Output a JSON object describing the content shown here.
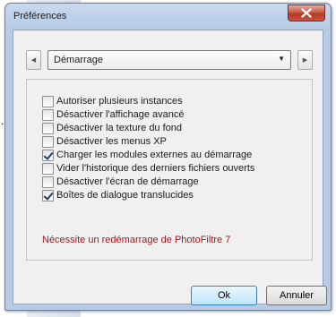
{
  "window": {
    "title": "Préférences",
    "close_icon": "close-icon"
  },
  "category": {
    "selected": "Démarrage",
    "prev_icon": "triangle-left-icon",
    "next_icon": "triangle-right-icon",
    "dropdown_icon": "triangle-down-icon"
  },
  "options": [
    {
      "label": "Autoriser plusieurs instances",
      "checked": false
    },
    {
      "label": "Désactiver l'affichage avancé",
      "checked": false
    },
    {
      "label": "Désactiver la texture du fond",
      "checked": false
    },
    {
      "label": "Désactiver les menus XP",
      "checked": false
    },
    {
      "label": "Charger les modules externes au démarrage",
      "checked": true
    },
    {
      "label": "Vider l'historique des derniers fichiers ouverts",
      "checked": false
    },
    {
      "label": "Désactiver l'écran de démarrage",
      "checked": false
    },
    {
      "label": "Boîtes de dialogue translucides",
      "checked": true
    }
  ],
  "note": "Nécessite un redémarrage de PhotoFiltre 7",
  "buttons": {
    "ok": "Ok",
    "cancel": "Annuler"
  },
  "colors": {
    "note": "#a01818",
    "close_button": "#c75d4a",
    "ok_border": "#3c7fb1"
  }
}
